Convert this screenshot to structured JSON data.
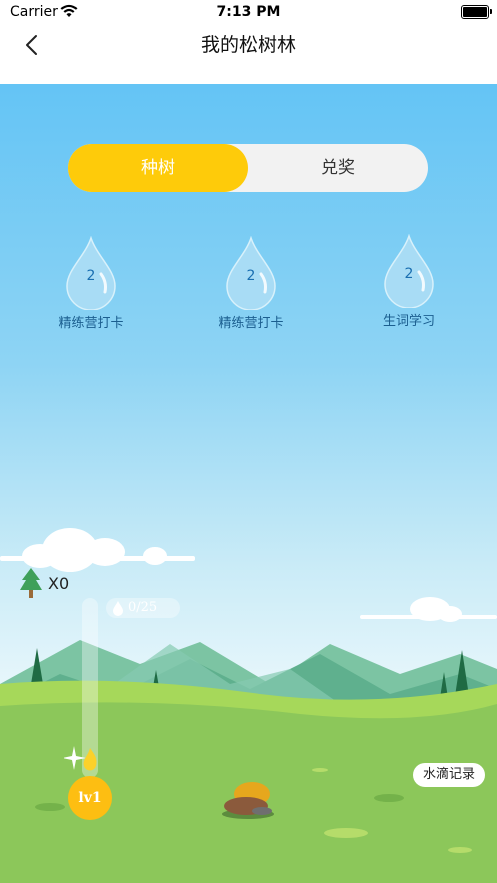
{
  "status_bar": {
    "carrier": "Carrier",
    "time": "7:13 PM"
  },
  "nav": {
    "title": "我的松树林"
  },
  "tabs": [
    {
      "label": "种树",
      "active": true
    },
    {
      "label": "兑奖",
      "active": false
    }
  ],
  "drops": [
    {
      "count": "2",
      "label": "精练营打卡"
    },
    {
      "count": "2",
      "label": "精练营打卡"
    },
    {
      "count": "2",
      "label": "生词学习"
    }
  ],
  "tree_count": "X0",
  "water_progress": {
    "text": "0/25",
    "current": 0,
    "target": 25
  },
  "level": "lv1",
  "water_record_label": "水滴记录",
  "colors": {
    "accent": "#fecb0a",
    "sky_top": "#64c4f5",
    "grass": "#8cc75a"
  }
}
